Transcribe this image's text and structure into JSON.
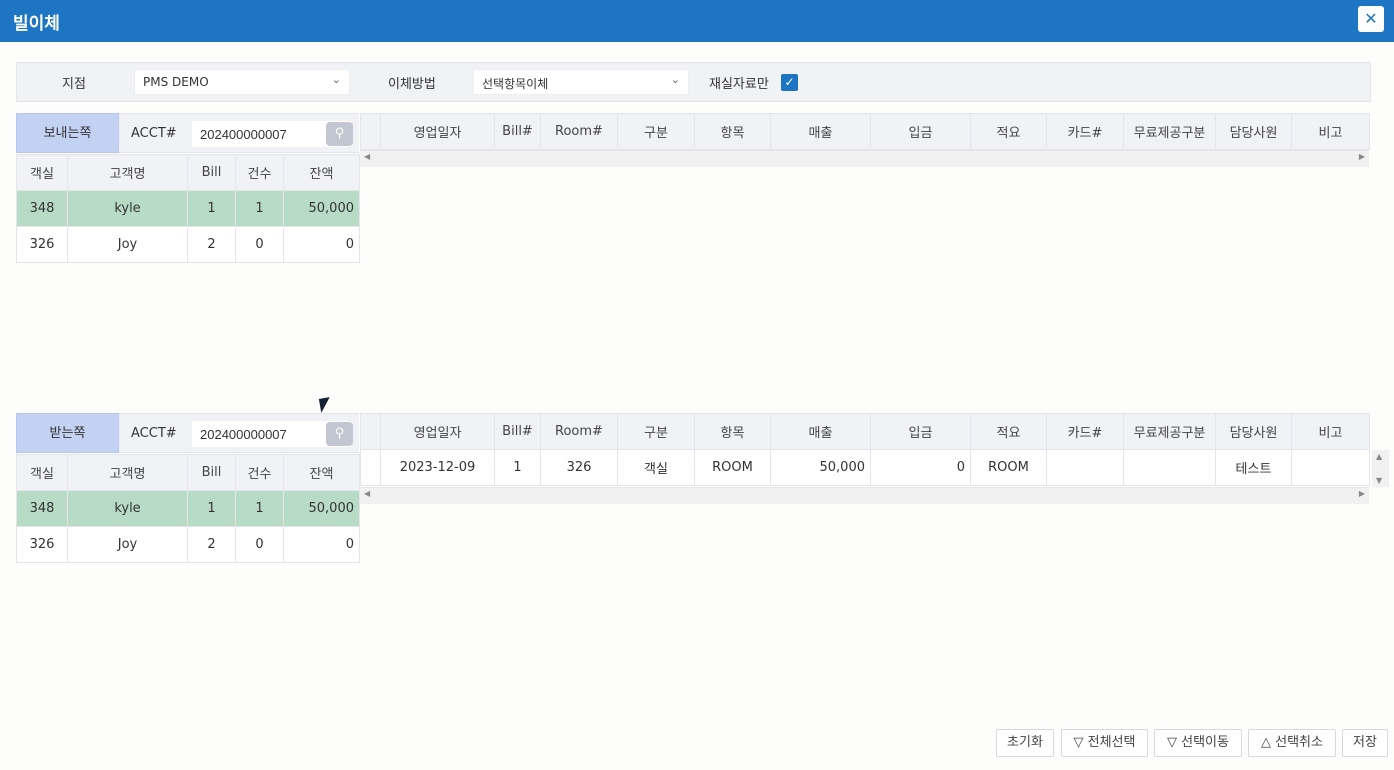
{
  "window": {
    "title": "빌이체",
    "close_icon": "close-icon"
  },
  "filter": {
    "branch_label": "지점",
    "branch_value": "PMS DEMO",
    "method_label": "이체방법",
    "method_value": "선택항목이체",
    "real_only_label": "재실자료만",
    "real_only_checked": true
  },
  "sender": {
    "label": "보내는쪽",
    "acct_label": "ACCT#",
    "acct_value": "202400000007",
    "columns": [
      "객실",
      "고객명",
      "Bill",
      "건수",
      "잔액"
    ],
    "rows": [
      {
        "room": "348",
        "name": "kyle",
        "bill": "1",
        "count": "1",
        "balance": "50,000",
        "selected": true
      },
      {
        "room": "326",
        "name": "Joy",
        "bill": "2",
        "count": "0",
        "balance": "0",
        "selected": false
      }
    ]
  },
  "receiver": {
    "label": "받는쪽",
    "acct_label": "ACCT#",
    "acct_value": "202400000007",
    "columns": [
      "객실",
      "고객명",
      "Bill",
      "건수",
      "잔액"
    ],
    "rows": [
      {
        "room": "348",
        "name": "kyle",
        "bill": "1",
        "count": "1",
        "balance": "50,000",
        "selected": true
      },
      {
        "room": "326",
        "name": "Joy",
        "bill": "2",
        "count": "0",
        "balance": "0",
        "selected": false
      }
    ]
  },
  "detail_columns": [
    "영업일자",
    "Bill#",
    "Room#",
    "구분",
    "항목",
    "매출",
    "입금",
    "적요",
    "카드#",
    "무료제공구분",
    "담당사원",
    "비고"
  ],
  "sender_detail_rows": [],
  "receiver_detail_rows": [
    {
      "date": "2023-12-09",
      "bill": "1",
      "room": "326",
      "type": "객실",
      "item": "ROOM",
      "sales": "50,000",
      "deposit": "0",
      "memo": "ROOM",
      "card": "",
      "free": "",
      "staff": "테스트",
      "note": ""
    }
  ],
  "buttons": {
    "reset": "초기화",
    "select_all": "▽ 전체선택",
    "move_selected": "▽ 선택이동",
    "cancel_selected": "△ 선택취소",
    "save": "저장"
  }
}
